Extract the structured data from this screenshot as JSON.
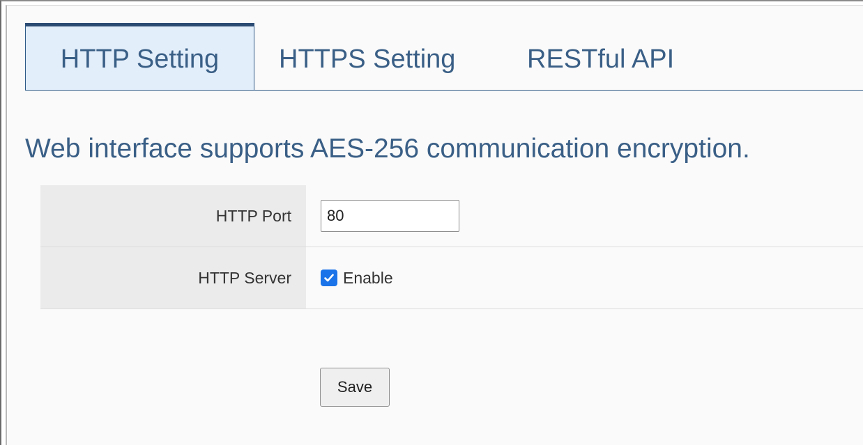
{
  "tabs": [
    {
      "label": "HTTP Setting",
      "active": true
    },
    {
      "label": "HTTPS Setting",
      "active": false
    },
    {
      "label": "RESTful API",
      "active": false
    }
  ],
  "headline": "Web interface supports AES-256 communication encryption.",
  "form": {
    "http_port": {
      "label": "HTTP Port",
      "value": "80"
    },
    "http_server": {
      "label": "HTTP Server",
      "checkbox_label": "Enable",
      "checked": true
    }
  },
  "save_label": "Save",
  "colors": {
    "accent_text": "#3a5f86",
    "tab_active_bg": "#e3eefb",
    "tab_border": "#2b4b73",
    "checkbox": "#1a73e8",
    "label_cell_bg": "#ebebeb"
  },
  "icons": {
    "checkbox": "checkmark-icon"
  }
}
